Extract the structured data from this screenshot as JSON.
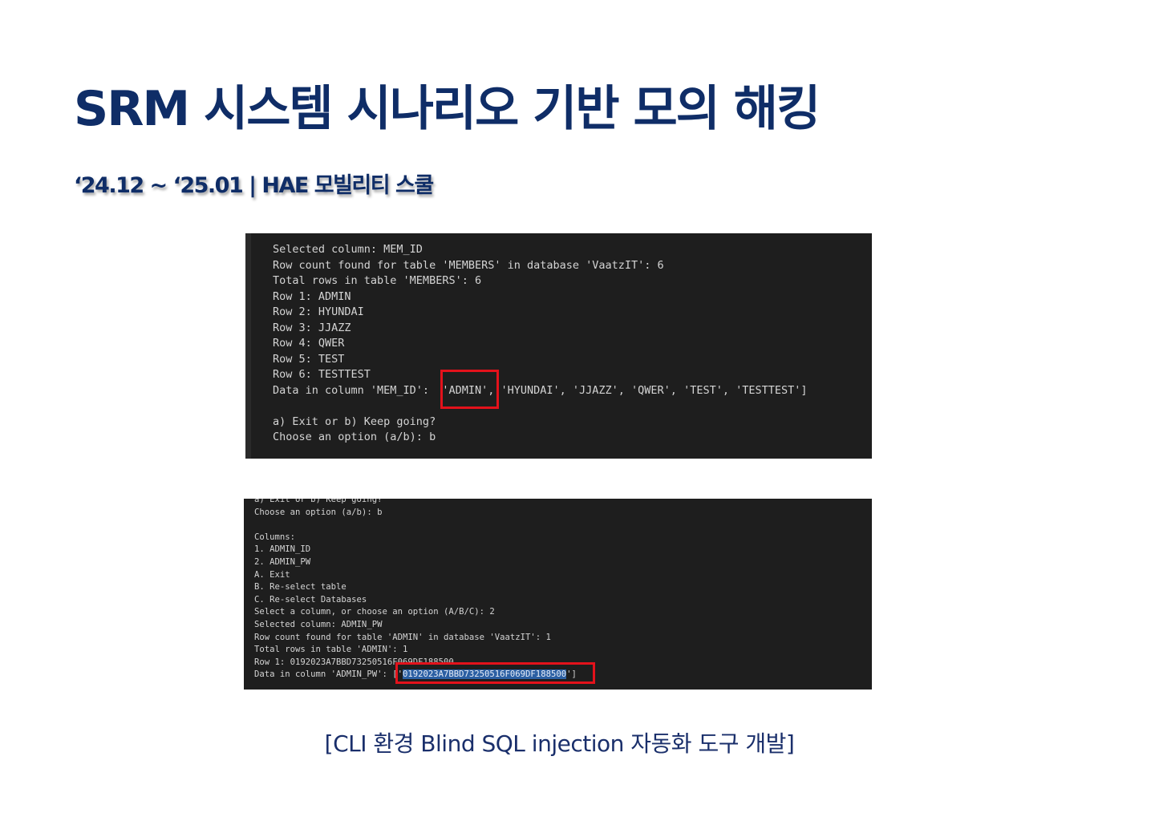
{
  "title": "SRM 시스템 시나리오 기반 모의 해킹",
  "subtitle": "‘24.12 ~ ‘25.01 | HAE 모빌리티 스쿨",
  "colors": {
    "title": "#0f2d67",
    "terminal_bg": "#1e1e1e",
    "highlight_box": "#e3121b",
    "selection": "#2b5fa3"
  },
  "terminal_1": {
    "lines": [
      "Selected column: MEM_ID",
      "Row count found for table 'MEMBERS' in database 'VaatzIT': 6",
      "Total rows in table 'MEMBERS': 6",
      "Row 1: ADMIN",
      "Row 2: HYUNDAI",
      "Row 3: JJAZZ",
      "Row 4: QWER",
      "Row 5: TEST",
      "Row 6: TESTTEST",
      "",
      "",
      "a) Exit or b) Keep going?",
      "Choose an option (a/b): b"
    ],
    "data_line": {
      "prefix": "Data in column 'MEM_ID':  ",
      "highlight": "'ADMIN'",
      "suffix": ", 'HYUNDAI', 'JJAZZ', 'QWER', 'TEST', 'TESTTEST']"
    }
  },
  "terminal_2": {
    "lines": [
      "a) Exit or b) Keep going?",
      "Choose an option (a/b): b",
      "",
      "Columns:",
      "1. ADMIN_ID",
      "2. ADMIN_PW",
      "A. Exit",
      "B. Re-select table",
      "C. Re-select Databases",
      "Select a column, or choose an option (A/B/C): 2",
      "Selected column: ADMIN_PW",
      "Row count found for table 'ADMIN' in database 'VaatzIT': 1",
      "Total rows in table 'ADMIN': 1",
      "Row 1: 0192023A7BBD73250516F069DF188500"
    ],
    "data_line": {
      "prefix": "Data in column 'ADMIN_PW': ",
      "open": "['",
      "highlight": "0192023A7BBD73250516F069DF188500",
      "close": "']"
    }
  },
  "caption": "[CLI 환경 Blind SQL injection 자동화 도구 개발]"
}
